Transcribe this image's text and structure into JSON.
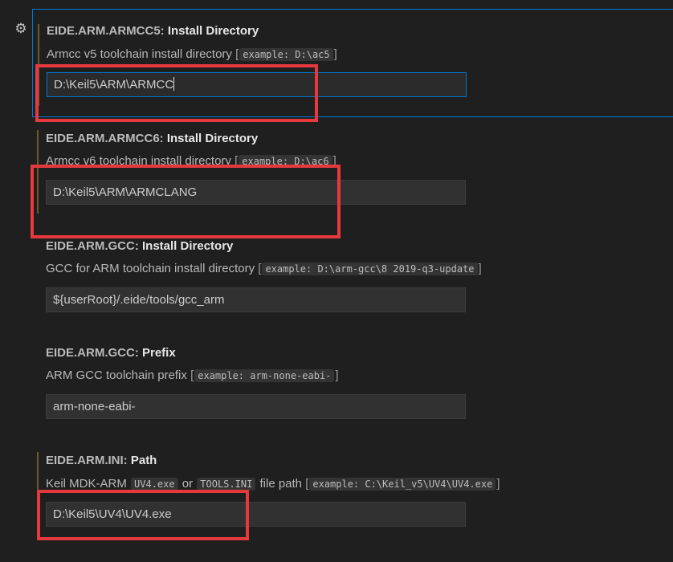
{
  "gear_icon": "gear-icon",
  "accent_color": "#0078d4",
  "highlight_color": "#e5393d",
  "settings": [
    {
      "category": "EIDE.ARM.ARMCC5: ",
      "key": "Install Directory",
      "desc_text": "Armcc v5 toolchain install directory ",
      "desc_open": "[",
      "desc_example": "example: D:\\ac5",
      "desc_close": "]",
      "value": "D:\\Keil5\\ARM\\ARMCC"
    },
    {
      "category": "EIDE.ARM.ARMCC6: ",
      "key": "Install Directory",
      "desc_text": "Armcc v6 toolchain install directory ",
      "desc_open": "[",
      "desc_example": "example: D:\\ac6",
      "desc_close": "]",
      "value": "D:\\Keil5\\ARM\\ARMCLANG"
    },
    {
      "category": "EIDE.ARM.GCC: ",
      "key": "Install Directory",
      "desc_text": "GCC for ARM toolchain install directory ",
      "desc_open": "[",
      "desc_example": "example: D:\\arm-gcc\\8 2019-q3-update",
      "desc_close": "]",
      "value": "${userRoot}/.eide/tools/gcc_arm"
    },
    {
      "category": "EIDE.ARM.GCC: ",
      "key": "Prefix",
      "desc_text": "ARM GCC toolchain prefix ",
      "desc_open": "[",
      "desc_example": "example: arm-none-eabi-",
      "desc_close": "]",
      "value": "arm-none-eabi-"
    },
    {
      "category": "EIDE.ARM.INI: ",
      "key": "Path",
      "desc_a": "Keil MDK-ARM ",
      "desc_code1": "UV4.exe",
      "desc_or": " or ",
      "desc_code2": "TOOLS.INI",
      "desc_b": " file path ",
      "desc_open": "[",
      "desc_example": "example: C:\\Keil_v5\\UV4\\UV4.exe",
      "desc_close": "]",
      "value": "D:\\Keil5\\UV4\\UV4.exe"
    }
  ]
}
